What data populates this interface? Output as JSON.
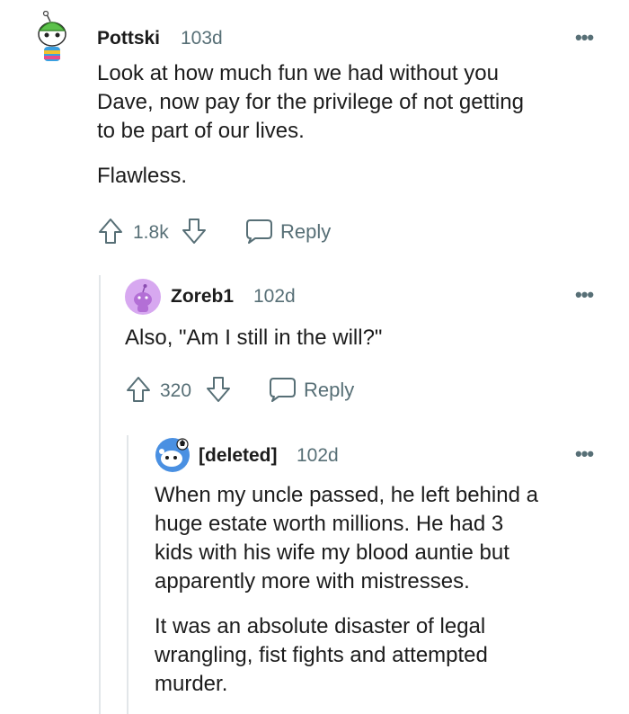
{
  "comments": [
    {
      "username": "Pottski",
      "age": "103d",
      "paragraphs": [
        "Look at how much fun we had without you",
        "Dave, now pay for the privilege of not getting",
        "to be part of our lives.",
        "Flawless."
      ],
      "votes": "1.8k",
      "reply_label": "Reply",
      "more_label": "•••"
    },
    {
      "username": "Zoreb1",
      "age": "102d",
      "paragraphs": [
        "Also, \"Am I still in the will?\""
      ],
      "votes": "320",
      "reply_label": "Reply",
      "more_label": "•••"
    },
    {
      "username": "[deleted]",
      "age": "102d",
      "paragraphs": [
        "When my uncle passed, he left behind a",
        "huge estate worth millions. He had 3",
        "kids with his wife my blood auntie but",
        "apparently more with mistresses.",
        "It was an absolute disaster of legal",
        "wrangling, fist fights and attempted",
        "murder."
      ],
      "more_label": "•••"
    }
  ],
  "icons": {
    "upvote": "upvote-arrow-icon",
    "downvote": "downvote-arrow-icon",
    "reply": "speech-bubble-icon"
  },
  "colors": {
    "muted": "#576f76",
    "thread_line": "#e2e6e9",
    "avatar_purple": "#d7a8f0",
    "avatar_blue": "#4a90e2"
  }
}
